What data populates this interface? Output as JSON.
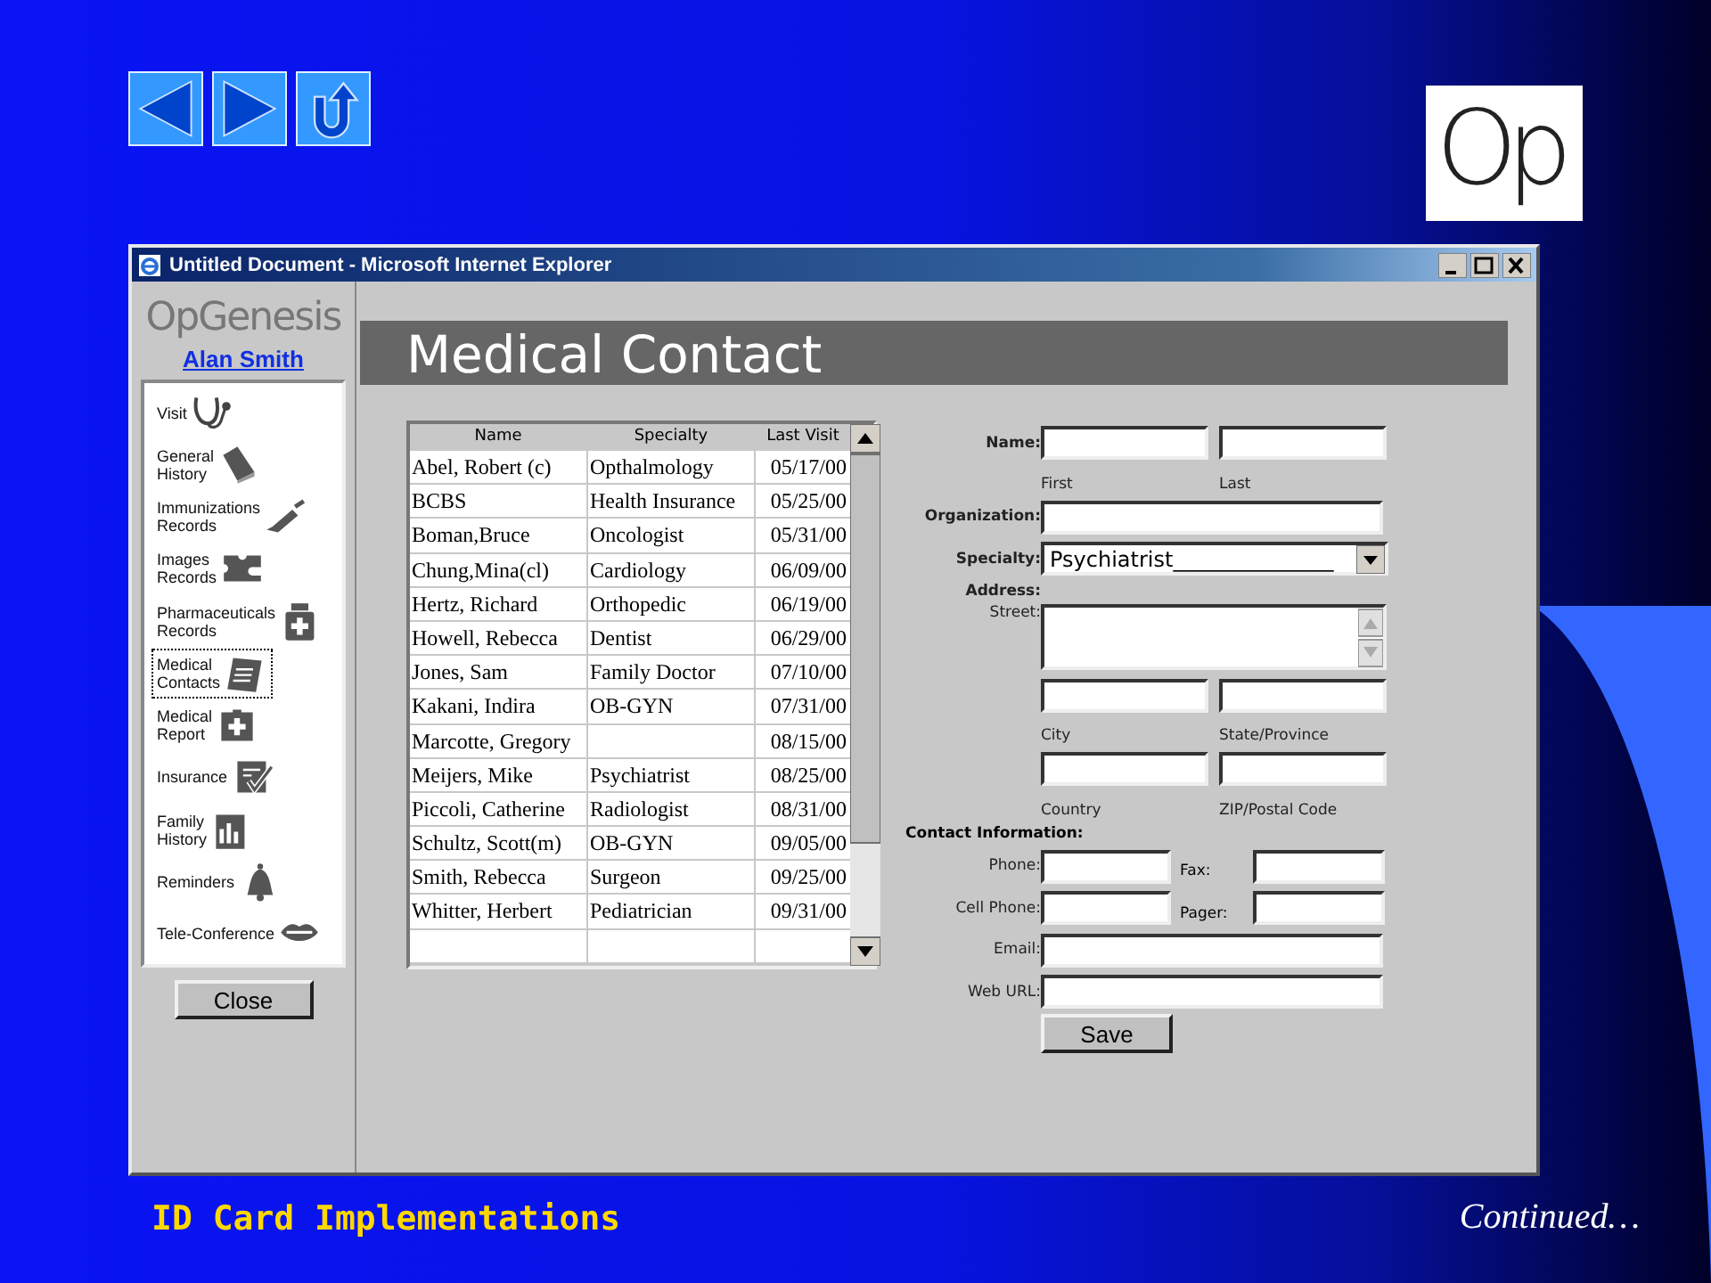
{
  "slide": {
    "logo_text": "Op",
    "footer_title": "ID Card Implementations",
    "footer_note": "Continued…"
  },
  "window": {
    "title": "Untitled Document - Microsoft Internet Explorer"
  },
  "sidebar": {
    "brand": "OpGenesis",
    "user_link": "Alan Smith",
    "close_button": "Close",
    "items": [
      {
        "label": "Visit",
        "selected": false
      },
      {
        "label": "General\nHistory",
        "selected": false
      },
      {
        "label": "Immunizations\nRecords",
        "selected": false
      },
      {
        "label": "Images\nRecords",
        "selected": false
      },
      {
        "label": "Pharmaceuticals\nRecords",
        "selected": false
      },
      {
        "label": "Medical\nContacts",
        "selected": true
      },
      {
        "label": "Medical\nReport",
        "selected": false
      },
      {
        "label": "Insurance",
        "selected": false
      },
      {
        "label": "Family\nHistory",
        "selected": false
      },
      {
        "label": "Reminders",
        "selected": false
      },
      {
        "label": "Tele-Conference",
        "selected": false
      }
    ]
  },
  "page_title": "Medical Contact",
  "table": {
    "columns": [
      "Name",
      "Specialty",
      "Last Visit"
    ],
    "rows": [
      {
        "name": "Abel, Robert (c)",
        "specialty": "Opthalmology",
        "last_visit": "05/17/00"
      },
      {
        "name": "BCBS",
        "specialty": "Health Insurance",
        "last_visit": "05/25/00"
      },
      {
        "name": "Boman,Bruce",
        "specialty": "Oncologist",
        "last_visit": "05/31/00"
      },
      {
        "name": "Chung,Mina(cl)",
        "specialty": "Cardiology",
        "last_visit": "06/09/00"
      },
      {
        "name": "Hertz, Richard",
        "specialty": "Orthopedic",
        "last_visit": "06/19/00"
      },
      {
        "name": "Howell, Rebecca",
        "specialty": "Dentist",
        "last_visit": "06/29/00"
      },
      {
        "name": "Jones, Sam",
        "specialty": "Family Doctor",
        "last_visit": "07/10/00"
      },
      {
        "name": "Kakani, Indira",
        "specialty": "OB-GYN",
        "last_visit": "07/31/00"
      },
      {
        "name": "Marcotte, Gregory",
        "last_visit": "08/15/00"
      },
      {
        "name": "Meijers, Mike",
        "specialty": "Psychiatrist",
        "last_visit": "08/25/00"
      },
      {
        "name": "Piccoli, Catherine",
        "specialty": "Radiologist",
        "last_visit": "08/31/00"
      },
      {
        "name": "Schultz, Scott(m)",
        "specialty": "OB-GYN",
        "last_visit": "09/05/00"
      },
      {
        "name": "Smith, Rebecca",
        "specialty": "Surgeon",
        "last_visit": "09/25/00"
      },
      {
        "name": "Whitter, Herbert",
        "specialty": "Pediatrician",
        "last_visit": "09/31/00"
      }
    ]
  },
  "form": {
    "name_label": "Name:",
    "first_caption": "First",
    "last_caption": "Last",
    "organization_label": "Organization:",
    "specialty_label": "Specialty:",
    "specialty_value": "Psychiatrist_______________",
    "address_label": "Address:",
    "street_label": "Street:",
    "city_caption": "City",
    "state_caption": "State/Province",
    "country_caption": "Country",
    "zip_caption": "ZIP/Postal Code",
    "contact_label": "Contact Information:",
    "phone_label": "Phone:",
    "fax_label": "Fax:",
    "cell_label": "Cell Phone:",
    "pager_label": "Pager:",
    "email_label": "Email:",
    "web_label": "Web URL:",
    "save_button": "Save"
  }
}
